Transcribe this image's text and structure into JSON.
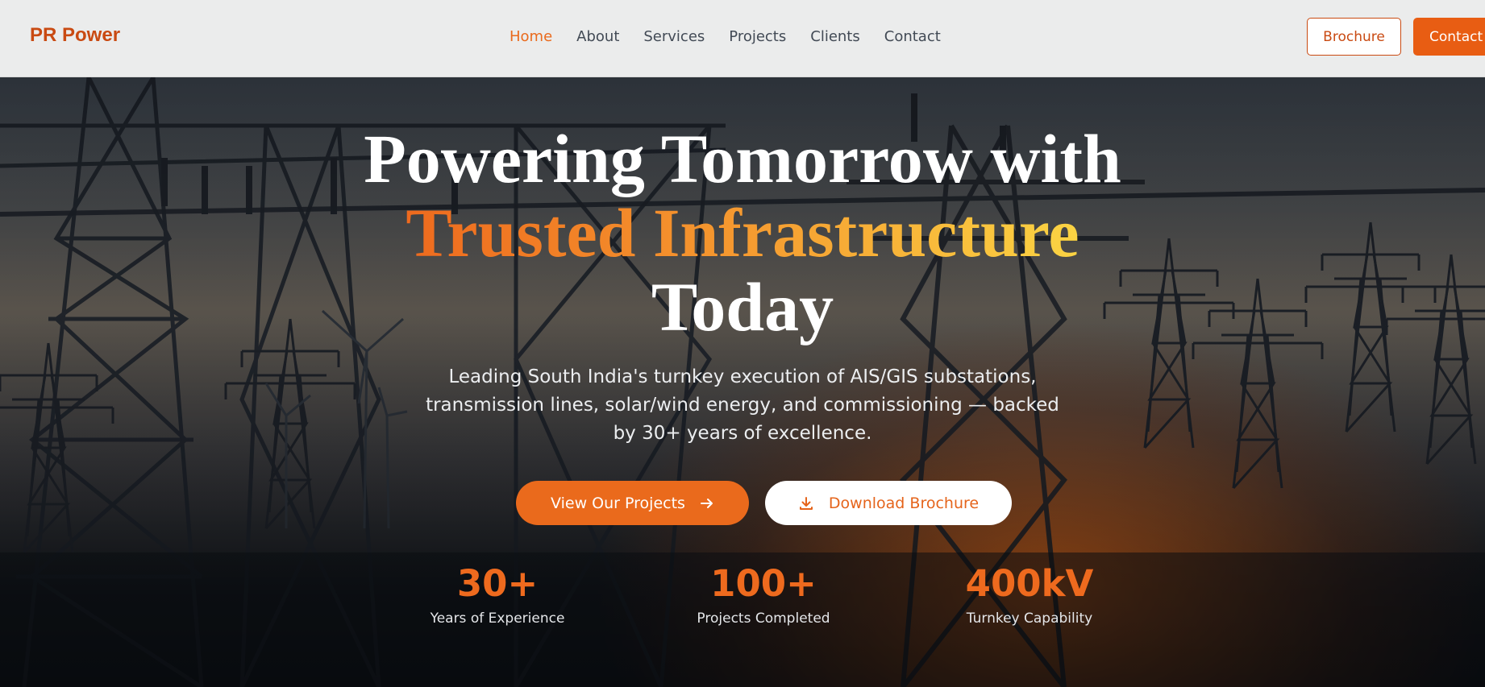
{
  "header": {
    "logo": "PR Power",
    "nav": [
      {
        "label": "Home",
        "active": true
      },
      {
        "label": "About",
        "active": false
      },
      {
        "label": "Services",
        "active": false
      },
      {
        "label": "Projects",
        "active": false
      },
      {
        "label": "Clients",
        "active": false
      },
      {
        "label": "Contact",
        "active": false
      }
    ],
    "brochure_label": "Brochure",
    "contact_label": "Contact"
  },
  "hero": {
    "title_line1": "Powering Tomorrow with",
    "title_highlight": "Trusted Infrastructure",
    "title_line3": "Today",
    "subtitle": "Leading South India's turnkey execution of AIS/GIS substations, transmission lines, solar/wind energy, and commissioning — backed by 30+ years of excellence.",
    "primary_cta": "View Our Projects",
    "secondary_cta": "Download Brochure",
    "stats": [
      {
        "value": "30+",
        "label": "Years of Experience"
      },
      {
        "value": "100+",
        "label": "Projects Completed"
      },
      {
        "value": "400kV",
        "label": "Turnkey Capability"
      }
    ]
  },
  "colors": {
    "brand": "#c94a12",
    "accent": "#ea6a1c",
    "highlight_gradient_end": "#fbd443"
  },
  "icons": {
    "primary_cta": "arrow-right-icon",
    "secondary_cta": "download-icon"
  }
}
